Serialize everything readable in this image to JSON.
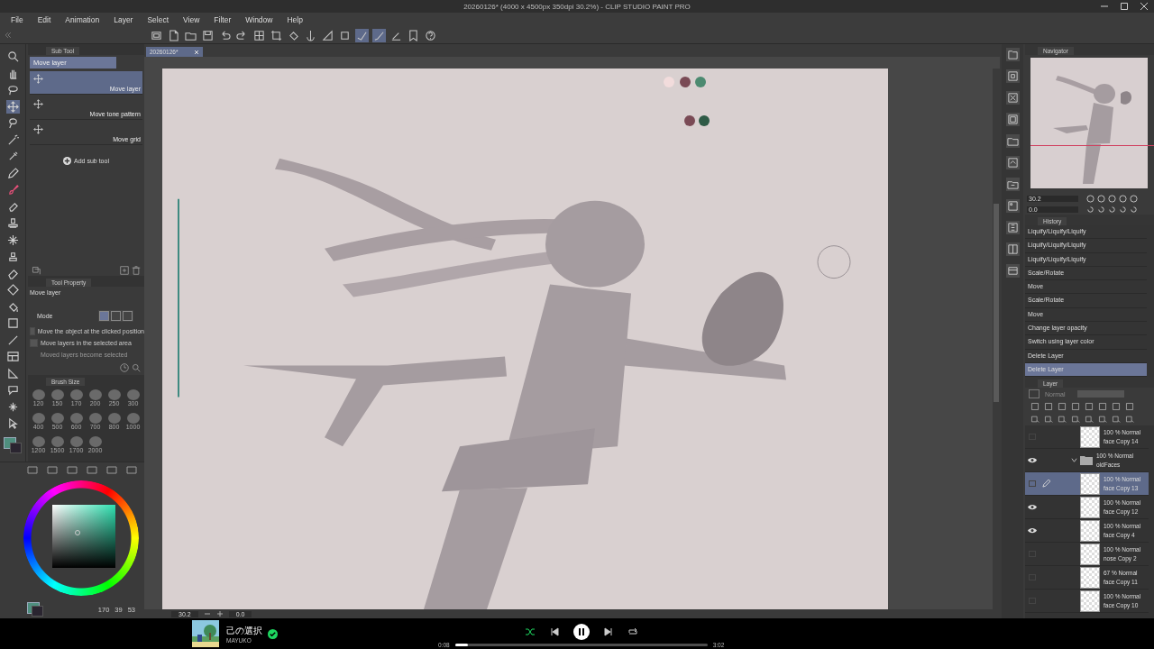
{
  "title_bar": {
    "title": "20260126* (4000 x 4500px 350dpi 30.2%) - CLIP STUDIO PAINT PRO"
  },
  "menu": [
    "File",
    "Edit",
    "Animation",
    "Layer",
    "Select",
    "View",
    "Filter",
    "Window",
    "Help"
  ],
  "document_tab": {
    "label": "20260126*"
  },
  "sub_tool": {
    "title": "Sub Tool",
    "group": "Move layer",
    "add_label": "Add sub tool",
    "items": [
      {
        "label": "Move layer",
        "selected": true
      },
      {
        "label": "Move tone pattern",
        "selected": false
      },
      {
        "label": "Move grid",
        "selected": false
      }
    ]
  },
  "tool_property": {
    "title": "Tool Property",
    "tool": "Move layer",
    "mode_label": "Mode",
    "options": [
      {
        "label": "Move the object at the clicked position",
        "checked": false,
        "disabled": false
      },
      {
        "label": "Move layers in the selected area",
        "checked": false,
        "disabled": false
      },
      {
        "label": "Moved layers become selected",
        "disabled": true
      }
    ]
  },
  "brush_size": {
    "title": "Brush Size",
    "sizes": [
      "120",
      "150",
      "170",
      "200",
      "250",
      "300",
      "400",
      "500",
      "600",
      "700",
      "800",
      "1000",
      "1200",
      "1500",
      "1700",
      "2000"
    ]
  },
  "color": {
    "readouts": [
      "170",
      "39",
      "53"
    ]
  },
  "navigator": {
    "title": "Navigator",
    "zoom": "30.2",
    "rotation": "0.0"
  },
  "history": {
    "title": "History",
    "items": [
      {
        "label": "Liquify/Liquify/Liquify",
        "selected": false
      },
      {
        "label": "Liquify/Liquify/Liquify",
        "selected": false
      },
      {
        "label": "Liquify/Liquify/Liquify",
        "selected": false
      },
      {
        "label": "Scale/Rotate",
        "selected": false
      },
      {
        "label": "Move",
        "selected": false
      },
      {
        "label": "Scale/Rotate",
        "selected": false
      },
      {
        "label": "Move",
        "selected": false
      },
      {
        "label": "Change layer opacity",
        "selected": false
      },
      {
        "label": "Switch using layer color",
        "selected": false
      },
      {
        "label": "Delete Layer",
        "selected": false
      },
      {
        "label": "Delete Layer",
        "selected": true
      }
    ]
  },
  "layers": {
    "title": "Layer",
    "blend_mode": "Normal",
    "opacity": {
      "level": 1
    },
    "items": [
      {
        "kind": "layer",
        "info": "100 % Normal",
        "name": "face Copy 14",
        "visible": false,
        "selected": false
      },
      {
        "kind": "folder",
        "info": "100 % Normal",
        "name": "oldFaces",
        "visible": true,
        "selected": false,
        "expanded": true,
        "children": [
          {
            "kind": "layer",
            "info": "100 % Normal",
            "name": "face Copy 13",
            "visible": false,
            "selected": true
          },
          {
            "kind": "layer",
            "info": "100 % Normal",
            "name": "face Copy 12",
            "visible": true,
            "selected": false
          },
          {
            "kind": "layer",
            "info": "100 % Normal",
            "name": "face Copy 4",
            "visible": true,
            "selected": false
          },
          {
            "kind": "layer",
            "info": "100 % Normal",
            "name": "nose Copy 2",
            "visible": false,
            "selected": false
          },
          {
            "kind": "layer",
            "info": "67 % Normal",
            "name": "face Copy 11",
            "visible": false,
            "selected": false
          },
          {
            "kind": "layer",
            "info": "100 % Normal",
            "name": "face Copy 10",
            "visible": false,
            "selected": false
          }
        ]
      }
    ]
  },
  "status_bar": {
    "zoom": "30.2",
    "rotation": "0.0"
  },
  "player": {
    "track": "己の選択",
    "artist": "MAYUKO",
    "saved": true,
    "playing": true,
    "elapsed": "0:08",
    "duration": "3:02",
    "level": 0.05
  }
}
